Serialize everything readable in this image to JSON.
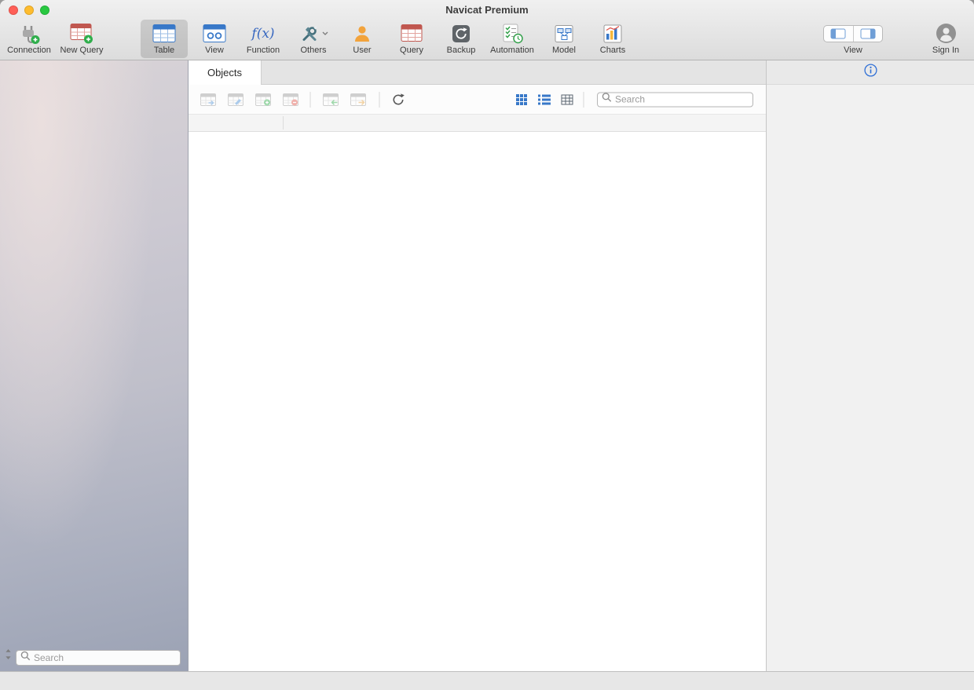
{
  "window": {
    "title": "Navicat Premium"
  },
  "toolbar": {
    "items": [
      {
        "label": "Connection",
        "icon": "connection-icon"
      },
      {
        "label": "New Query",
        "icon": "new-query-icon"
      },
      {
        "label": "Table",
        "icon": "table-icon",
        "selected": true
      },
      {
        "label": "View",
        "icon": "view-icon"
      },
      {
        "label": "Function",
        "icon": "function-icon",
        "icon_text": "f(x)"
      },
      {
        "label": "Others",
        "icon": "tools-icon"
      },
      {
        "label": "User",
        "icon": "user-icon"
      },
      {
        "label": "Query",
        "icon": "query-icon"
      },
      {
        "label": "Backup",
        "icon": "backup-icon"
      },
      {
        "label": "Automation",
        "icon": "automation-icon"
      },
      {
        "label": "Model",
        "icon": "model-icon"
      },
      {
        "label": "Charts",
        "icon": "charts-icon"
      }
    ],
    "right": {
      "view_label": "View",
      "sign_in_label": "Sign In"
    }
  },
  "main": {
    "tabs": [
      {
        "label": "Objects",
        "active": true
      }
    ],
    "toolbar": {
      "search_placeholder": "Search"
    }
  },
  "sidebar": {
    "search_placeholder": "Search"
  },
  "colors": {
    "accent_blue": "#3878c8",
    "traffic_red": "#ff5f57",
    "traffic_yellow": "#febc2e",
    "traffic_green": "#28c840",
    "info_blue": "#2f6fd6"
  }
}
